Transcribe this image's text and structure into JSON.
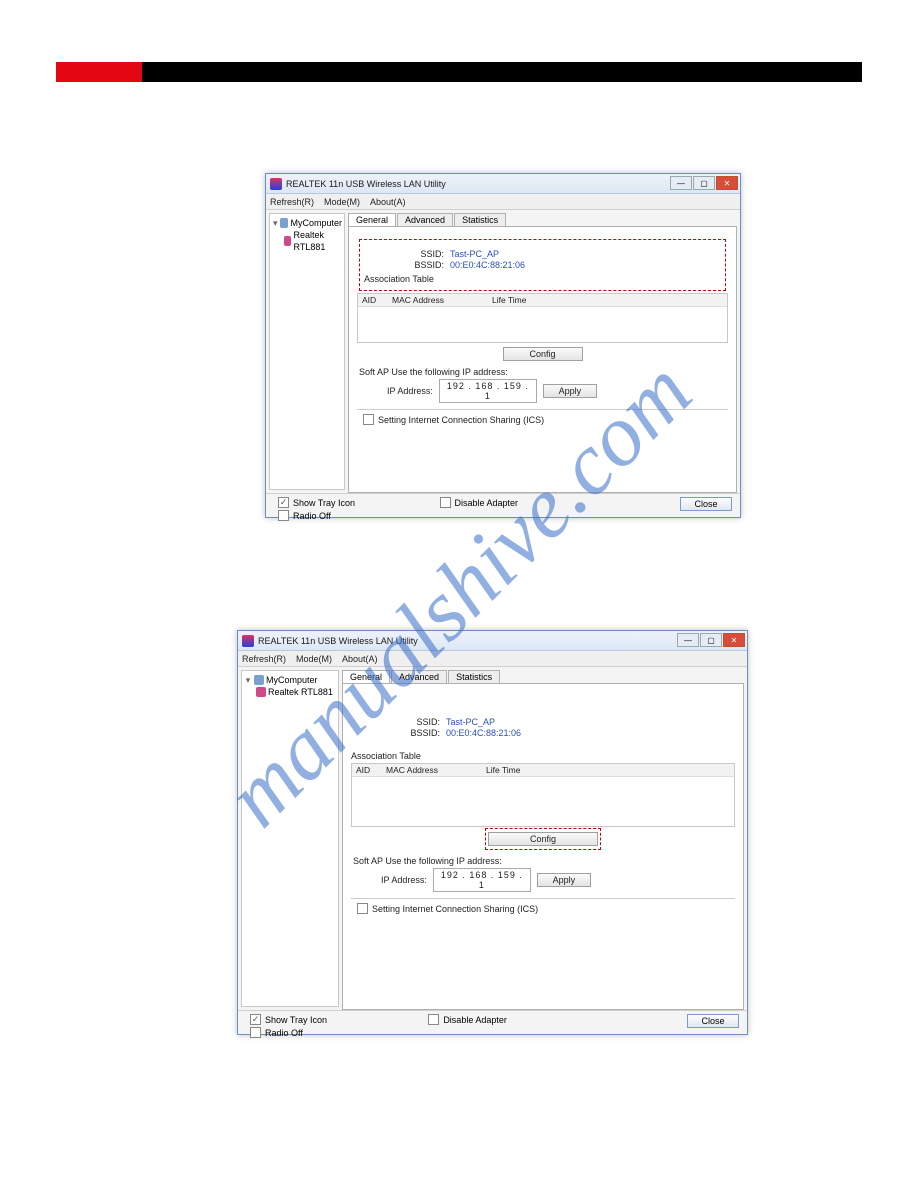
{
  "watermark": "manualshive.com",
  "window": {
    "title": "REALTEK 11n USB Wireless LAN Utility",
    "menu": {
      "refresh": "Refresh(R)",
      "mode": "Mode(M)",
      "about": "About(A)"
    },
    "tree": {
      "root": "MyComputer",
      "child": "Realtek RTL881"
    },
    "tabs": {
      "general": "General",
      "advanced": "Advanced",
      "statistics": "Statistics"
    },
    "ssid": {
      "label": "SSID:",
      "value": "Tast-PC_AP"
    },
    "bssid": {
      "label": "BSSID:",
      "value": "00:E0:4C:88:21:06"
    },
    "assoc_label": "Association Table",
    "cols": {
      "aid": "AID",
      "mac": "MAC Address",
      "life": "Life Time"
    },
    "config_btn": "Config",
    "ip_section": {
      "title": "Soft AP Use the following IP address:",
      "label": "IP Address:",
      "value": "192 . 168 . 159 .   1",
      "apply": "Apply"
    },
    "ics": "Setting Internet Connection Sharing (ICS)",
    "footer": {
      "tray": "Show Tray Icon",
      "radio": "Radio Off",
      "disable": "Disable Adapter",
      "close": "Close"
    },
    "winbtns": {
      "min": "—",
      "max": "▢",
      "close": "✕"
    }
  }
}
